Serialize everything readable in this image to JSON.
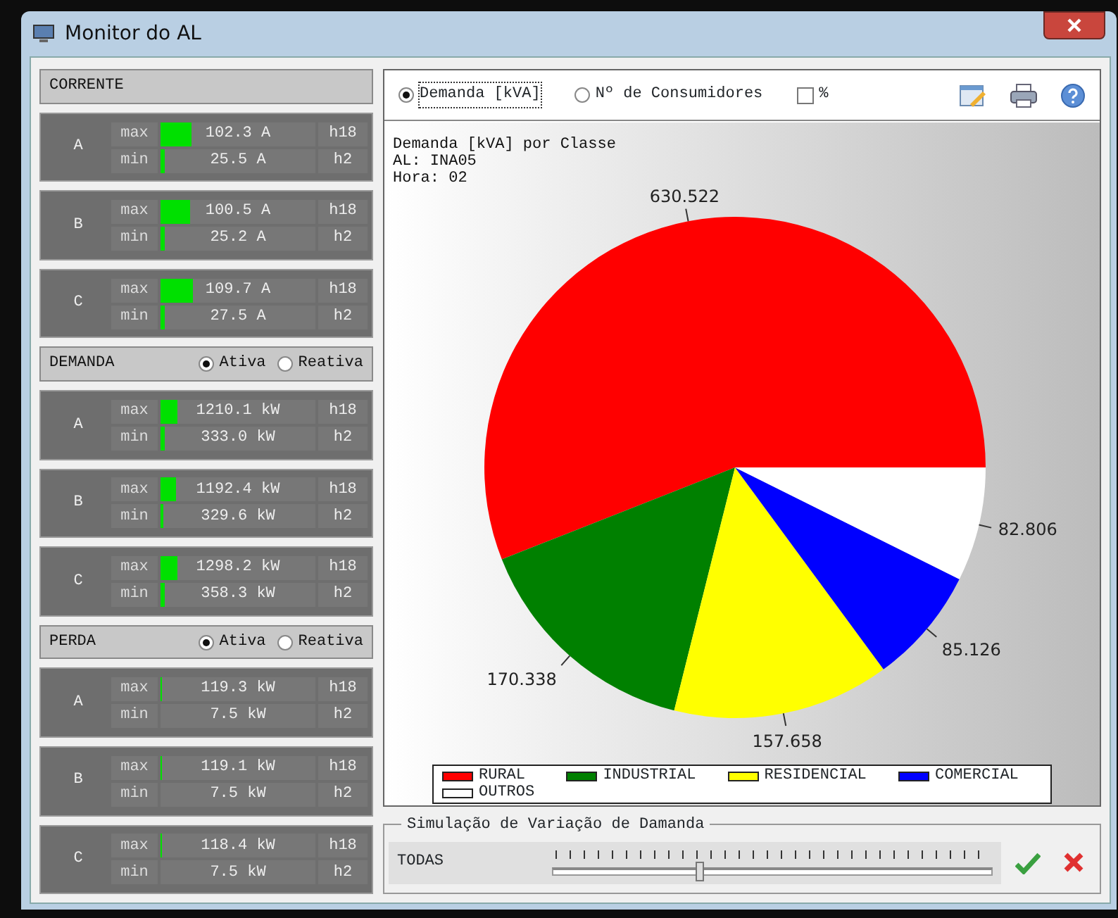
{
  "window": {
    "title": "Monitor do AL"
  },
  "panels": [
    {
      "title": "CORRENTE",
      "phases": [
        {
          "phase": "A",
          "rows": [
            {
              "label": "max",
              "level": 0.2,
              "value": "102.3 A",
              "hour": "h18"
            },
            {
              "label": "min",
              "level": 0.03,
              "value": "25.5 A",
              "hour": "h2"
            }
          ]
        },
        {
          "phase": "B",
          "rows": [
            {
              "label": "max",
              "level": 0.19,
              "value": "100.5 A",
              "hour": "h18"
            },
            {
              "label": "min",
              "level": 0.03,
              "value": "25.2 A",
              "hour": "h2"
            }
          ]
        },
        {
          "phase": "C",
          "rows": [
            {
              "label": "max",
              "level": 0.21,
              "value": "109.7 A",
              "hour": "h18"
            },
            {
              "label": "min",
              "level": 0.03,
              "value": "27.5 A",
              "hour": "h2"
            }
          ]
        }
      ]
    },
    {
      "title": "DEMANDA",
      "options": [
        {
          "label": "Ativa",
          "selected": true
        },
        {
          "label": "Reativa",
          "selected": false
        }
      ],
      "phases": [
        {
          "phase": "A",
          "rows": [
            {
              "label": "max",
              "level": 0.11,
              "value": "1210.1 kW",
              "hour": "h18"
            },
            {
              "label": "min",
              "level": 0.03,
              "value": "333.0 kW",
              "hour": "h2"
            }
          ]
        },
        {
          "phase": "B",
          "rows": [
            {
              "label": "max",
              "level": 0.1,
              "value": "1192.4 kW",
              "hour": "h18"
            },
            {
              "label": "min",
              "level": 0.02,
              "value": "329.6 kW",
              "hour": "h2"
            }
          ]
        },
        {
          "phase": "C",
          "rows": [
            {
              "label": "max",
              "level": 0.11,
              "value": "1298.2 kW",
              "hour": "h18"
            },
            {
              "label": "min",
              "level": 0.03,
              "value": "358.3 kW",
              "hour": "h2"
            }
          ]
        }
      ]
    },
    {
      "title": "PERDA",
      "options": [
        {
          "label": "Ativa",
          "selected": true
        },
        {
          "label": "Reativa",
          "selected": false
        }
      ],
      "phases": [
        {
          "phase": "A",
          "rows": [
            {
              "label": "max",
              "level": 0.01,
              "value": "119.3 kW",
              "hour": "h18"
            },
            {
              "label": "min",
              "value": "7.5 kW",
              "hour": "h2"
            }
          ]
        },
        {
          "phase": "B",
          "rows": [
            {
              "label": "max",
              "level": 0.01,
              "value": "119.1 kW",
              "hour": "h18"
            },
            {
              "label": "min",
              "value": "7.5 kW",
              "hour": "h2"
            }
          ]
        },
        {
          "phase": "C",
          "rows": [
            {
              "label": "max",
              "level": 0.01,
              "value": "118.4 kW",
              "hour": "h18"
            },
            {
              "label": "min",
              "value": "7.5 kW",
              "hour": "h2"
            }
          ]
        }
      ]
    }
  ],
  "toolbar": {
    "modes": [
      {
        "label": "Demanda [kVA]",
        "selected": true
      },
      {
        "label": "Nº de Consumidores",
        "selected": false
      }
    ],
    "percent": {
      "label": "%",
      "checked": false
    }
  },
  "chart": {
    "heading": [
      "AL: INA05",
      "Hora: 02"
    ],
    "chart_data": {
      "type": "pie",
      "title": "Demanda [kVA] por Classe",
      "categories": [
        "RURAL",
        "INDUSTRIAL",
        "RESIDENCIAL",
        "COMERCIAL",
        "OUTROS"
      ],
      "values": [
        630.522,
        170.338,
        157.658,
        85.126,
        82.806
      ],
      "data_labels": true
    },
    "legend": [
      {
        "color": "#ff0000"
      },
      {
        "color": "#008000"
      },
      {
        "color": "#ffff00"
      },
      {
        "color": "#0000ff"
      },
      {
        "color": "#ffffff"
      }
    ]
  },
  "simulation": {
    "title": "Simulação de Variação de Damanda",
    "label": "TODAS",
    "level": 0.335
  }
}
